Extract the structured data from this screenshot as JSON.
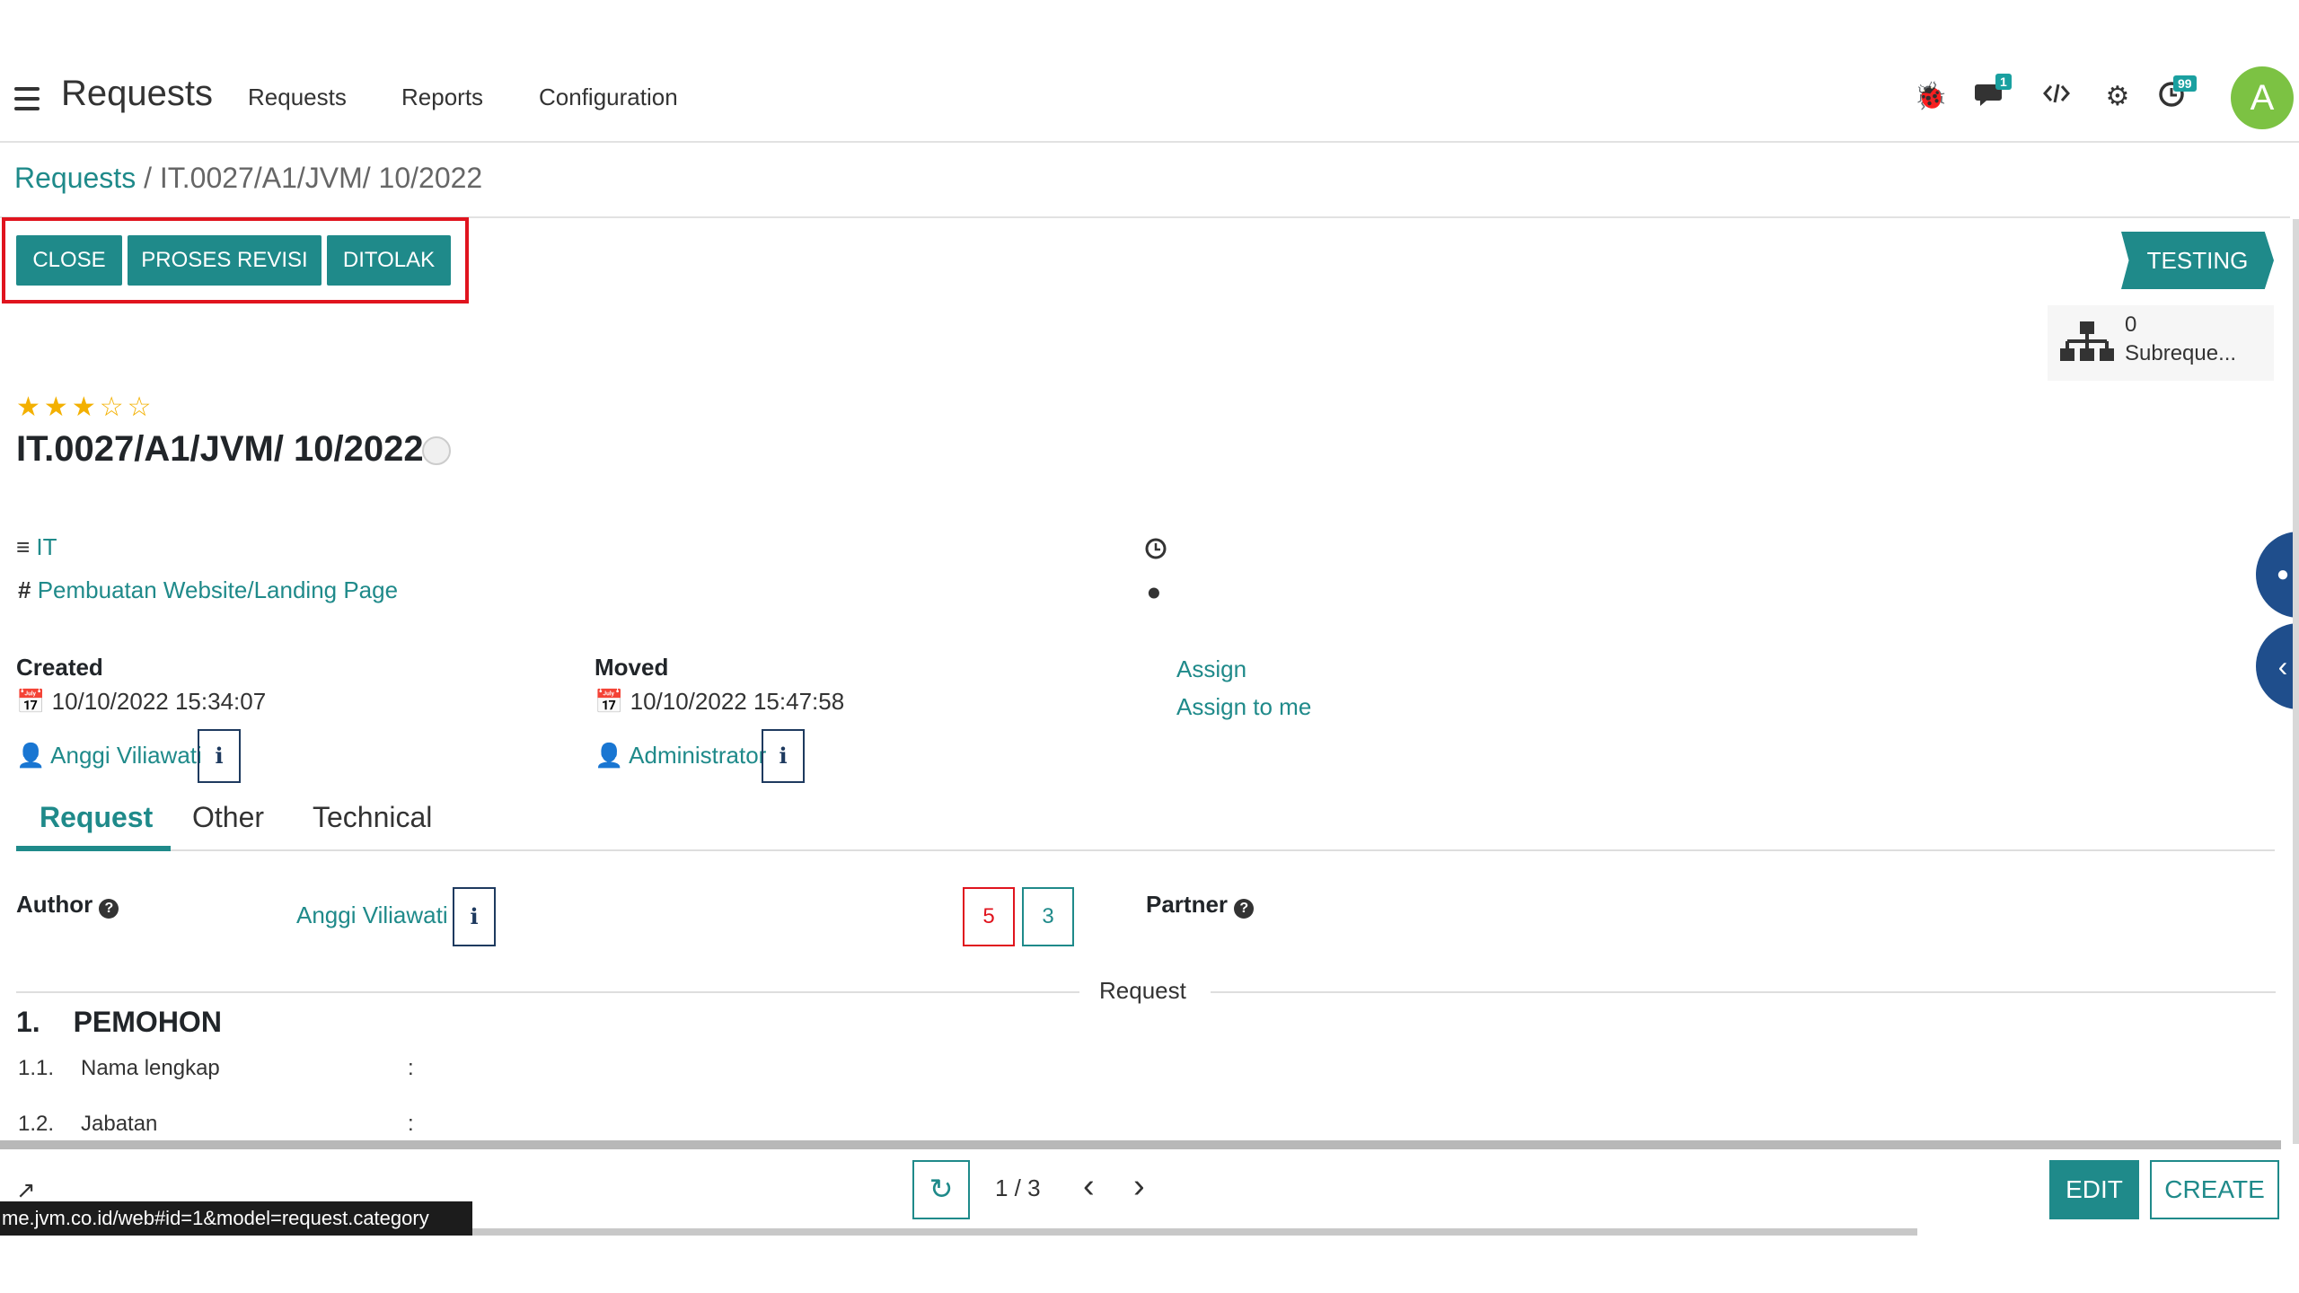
{
  "navbar": {
    "app_title": "Requests",
    "menu": [
      "Requests",
      "Reports",
      "Configuration"
    ],
    "icons": [
      "bug-icon",
      "chat-icon",
      "code-icon",
      "gear-icon",
      "clock-icon"
    ],
    "chat_badge": "1",
    "activity_badge": "99",
    "avatar_letter": "A",
    "avatar_color": "#7cc243"
  },
  "breadcrumb": {
    "parent": "Requests",
    "separator": "/",
    "current": "IT.0027/A1/JVM/ 10/2022"
  },
  "actions": {
    "close": "CLOSE",
    "proses_revisi": "PROSES REVISI",
    "ditolak": "DITOLAK"
  },
  "status": {
    "stage": "TESTING"
  },
  "smart_button": {
    "count": "0",
    "label": "Subreque..."
  },
  "record": {
    "priority_stars": 3,
    "priority_max": 5,
    "title": "IT.0027/A1/JVM/ 10/2022",
    "category": "IT",
    "type": "Pembuatan Website/Landing Page",
    "created_label": "Created",
    "created_date": "10/10/2022 15:34:07",
    "created_by": "Anggi Viliawati",
    "moved_label": "Moved",
    "moved_date": "10/10/2022 15:47:58",
    "moved_by": "Administrator",
    "assign": "Assign",
    "assign_to_me": "Assign to me",
    "info_glyph": "i"
  },
  "tabs": [
    "Request",
    "Other",
    "Technical"
  ],
  "request_tab": {
    "author_label": "Author",
    "author_value": "Anggi Viliawati",
    "count_red": "5",
    "count_teal": "3",
    "partner_label": "Partner",
    "separator_label": "Request",
    "section_number": "1.",
    "section_title": "PEMOHON",
    "rows": [
      {
        "num": "1.1.",
        "label": "Nama lengkap",
        "colon": ":"
      },
      {
        "num": "1.2.",
        "label": "Jabatan",
        "colon": ":"
      }
    ]
  },
  "pager": {
    "value": "1 / 3"
  },
  "buttons": {
    "edit": "EDIT",
    "create": "CREATE"
  },
  "tooltip": "me.jvm.co.id/web#id=1&model=request.category",
  "colors": {
    "primary": "#1f8a8a",
    "highlight": "#e0141e",
    "star": "#f3b000",
    "side_button": "#1f4e8c"
  }
}
